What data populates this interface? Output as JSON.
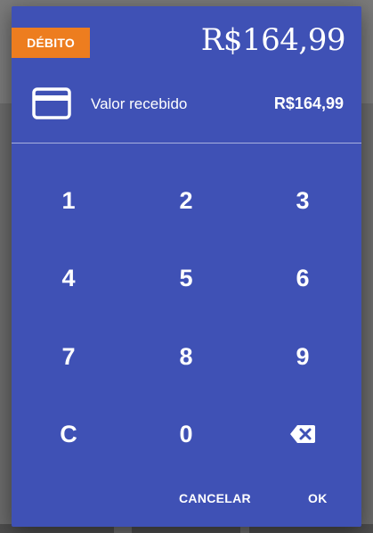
{
  "payment": {
    "method_badge": "DÉBITO",
    "total": "R$164,99",
    "received_label": "Valor recebido",
    "received_value": "R$164,99",
    "card_icon": "credit-card-icon"
  },
  "keypad": {
    "keys": [
      "1",
      "2",
      "3",
      "4",
      "5",
      "6",
      "7",
      "8",
      "9",
      "C",
      "0"
    ],
    "backspace_icon": "backspace-icon"
  },
  "actions": {
    "cancel_label": "CANCELAR",
    "ok_label": "OK"
  },
  "colors": {
    "dialog_bg": "#3f51b5",
    "badge_bg": "#ed7d1f",
    "text": "#ffffff"
  }
}
